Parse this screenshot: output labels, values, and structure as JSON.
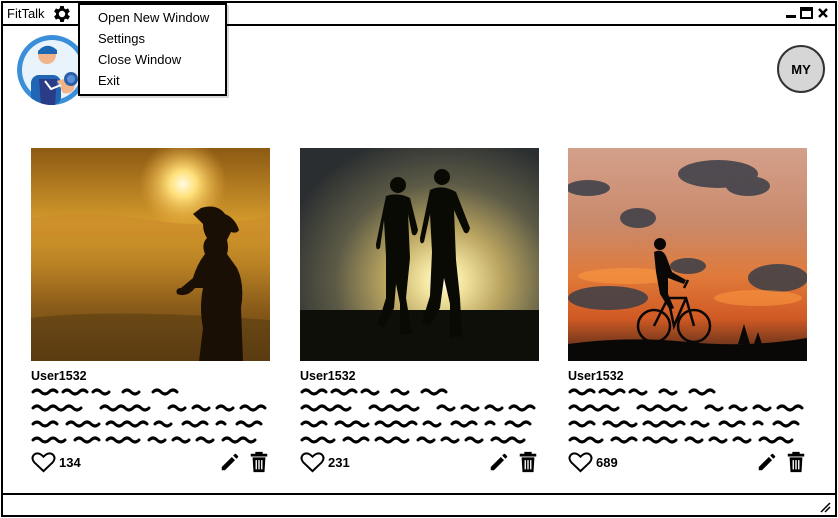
{
  "app": {
    "title": "FitTalk"
  },
  "menu": {
    "items": [
      {
        "label": "Open New Window"
      },
      {
        "label": "Settings"
      },
      {
        "label": "Close Window"
      },
      {
        "label": "Exit"
      }
    ]
  },
  "profile": {
    "initials": "MY"
  },
  "posts": [
    {
      "user": "User1532",
      "likes": "134",
      "image": "woman-running-at-sunset"
    },
    {
      "user": "User1532",
      "likes": "231",
      "image": "two-men-running-at-sunset"
    },
    {
      "user": "User1532",
      "likes": "689",
      "image": "cyclist-at-sunset"
    }
  ],
  "icons": [
    "gear-icon",
    "minimize-icon",
    "maximize-icon",
    "close-icon",
    "heart-icon",
    "pencil-icon",
    "trash-icon",
    "resize-icon"
  ]
}
